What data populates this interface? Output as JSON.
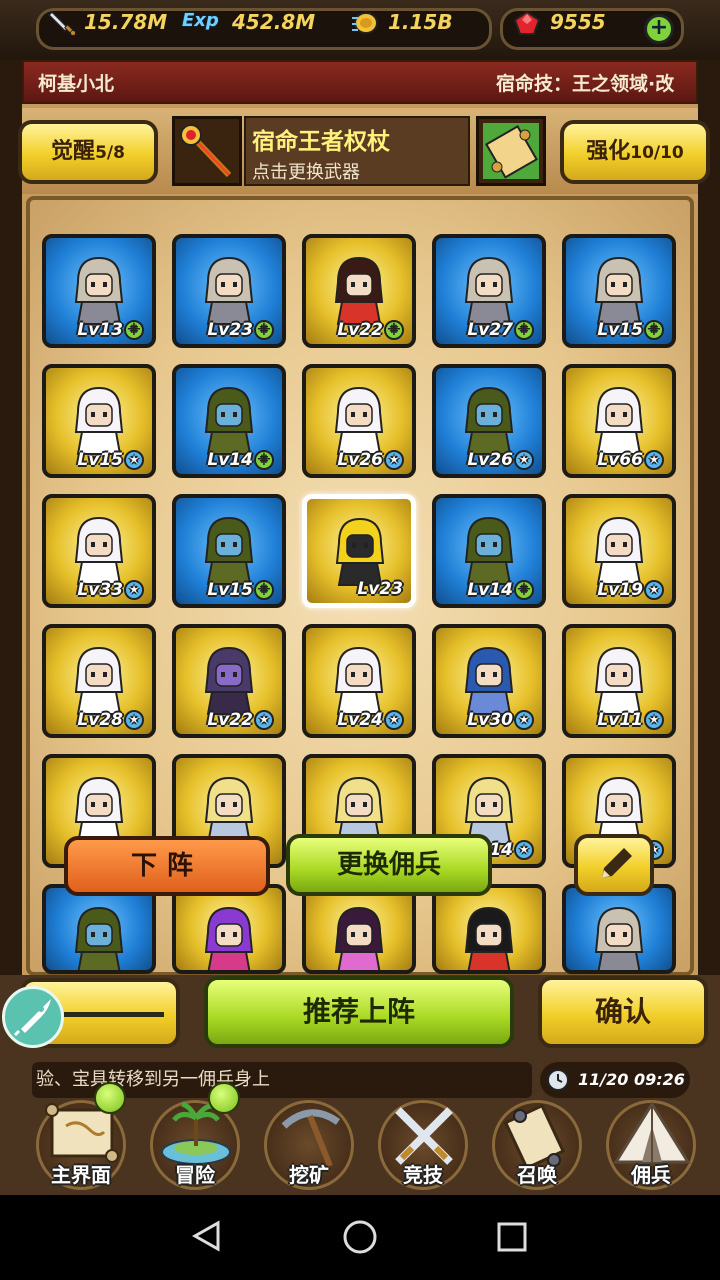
{
  "resources": {
    "attack": "15.78M",
    "exp": "452.8M",
    "gold": "1.15B",
    "gems": "9555",
    "exp_icon_text": "Exp"
  },
  "name_bar": {
    "player_name": "柯基小北",
    "destiny_skill": "宿命技：王之领域·改"
  },
  "weapon_bar": {
    "awaken_label": "觉醒",
    "awaken_value": "5/8",
    "weapon_name": "宿命王者权杖",
    "weapon_hint": "点击更换武器",
    "enhance_label": "强化",
    "enhance_value": "10/10"
  },
  "cards": [
    {
      "lv": "Lv13",
      "rarity": "blue",
      "badge": "plus",
      "hero": "grey-hair"
    },
    {
      "lv": "Lv23",
      "rarity": "blue",
      "badge": "plus",
      "hero": "grey-hair"
    },
    {
      "lv": "Lv22",
      "rarity": "gold",
      "badge": "plus",
      "hero": "red-armor"
    },
    {
      "lv": "Lv27",
      "rarity": "blue",
      "badge": "plus",
      "hero": "grey-hair"
    },
    {
      "lv": "Lv15",
      "rarity": "blue",
      "badge": "plus",
      "hero": "grey-hair"
    },
    {
      "lv": "Lv15",
      "rarity": "gold",
      "badge": "star",
      "hero": "white-hair"
    },
    {
      "lv": "Lv14",
      "rarity": "blue",
      "badge": "plus",
      "hero": "green-cloak"
    },
    {
      "lv": "Lv26",
      "rarity": "gold",
      "badge": "star",
      "hero": "white-hair"
    },
    {
      "lv": "Lv26",
      "rarity": "blue",
      "badge": "star",
      "hero": "green-cloak"
    },
    {
      "lv": "Lv66",
      "rarity": "gold",
      "badge": "star",
      "hero": "white-hair"
    },
    {
      "lv": "Lv33",
      "rarity": "gold",
      "badge": "star",
      "hero": "white-hair"
    },
    {
      "lv": "Lv15",
      "rarity": "blue",
      "badge": "plus",
      "hero": "green-cloak"
    },
    {
      "lv": "Lv23",
      "rarity": "gold",
      "badge": "none",
      "hero": "yellow-helmet",
      "selected": true
    },
    {
      "lv": "Lv14",
      "rarity": "blue",
      "badge": "plus",
      "hero": "green-cloak"
    },
    {
      "lv": "Lv19",
      "rarity": "gold",
      "badge": "star",
      "hero": "white-hair"
    },
    {
      "lv": "Lv28",
      "rarity": "gold",
      "badge": "star",
      "hero": "white-hair"
    },
    {
      "lv": "Lv22",
      "rarity": "gold",
      "badge": "star",
      "hero": "purple-demon"
    },
    {
      "lv": "Lv24",
      "rarity": "gold",
      "badge": "star",
      "hero": "white-hair"
    },
    {
      "lv": "Lv30",
      "rarity": "gold",
      "badge": "star",
      "hero": "blue-wizard"
    },
    {
      "lv": "Lv11",
      "rarity": "gold",
      "badge": "star",
      "hero": "white-hair"
    },
    {
      "lv": "",
      "rarity": "gold",
      "badge": "none",
      "hero": "white-hair"
    },
    {
      "lv": "",
      "rarity": "gold",
      "badge": "none",
      "hero": "blonde-knight"
    },
    {
      "lv": "",
      "rarity": "gold",
      "badge": "none",
      "hero": "blonde-knight"
    },
    {
      "lv": "14",
      "rarity": "gold",
      "badge": "star",
      "hero": "blonde-knight"
    },
    {
      "lv": "",
      "rarity": "gold",
      "badge": "star",
      "hero": "white-hair"
    },
    {
      "lv": "",
      "rarity": "blue",
      "badge": "none",
      "hero": "green-cloak"
    },
    {
      "lv": "",
      "rarity": "gold",
      "badge": "none",
      "hero": "purple-mage"
    },
    {
      "lv": "",
      "rarity": "gold",
      "badge": "none",
      "hero": "pink-flower"
    },
    {
      "lv": "",
      "rarity": "gold",
      "badge": "none",
      "hero": "black-hair"
    },
    {
      "lv": "",
      "rarity": "blue",
      "badge": "none",
      "hero": "grey-hair"
    }
  ],
  "popup": {
    "remove_label": "下阵",
    "replace_label": "更换佣兵"
  },
  "actions": {
    "recommend_label": "推荐上阵",
    "confirm_label": "确认"
  },
  "ticker": {
    "message": "验、宝具转移到另一佣兵身上",
    "clock": "11/20 09:26"
  },
  "nav": [
    {
      "label": "主界面",
      "icon": "map-scroll-icon",
      "dot": true
    },
    {
      "label": "冒险",
      "icon": "island-icon",
      "dot": true
    },
    {
      "label": "挖矿",
      "icon": "pickaxe-icon",
      "dot": false
    },
    {
      "label": "竞技",
      "icon": "crossed-swords-icon",
      "dot": false
    },
    {
      "label": "召唤",
      "icon": "summon-scroll-icon",
      "dot": false
    },
    {
      "label": "佣兵",
      "icon": "tent-icon",
      "dot": false
    }
  ]
}
